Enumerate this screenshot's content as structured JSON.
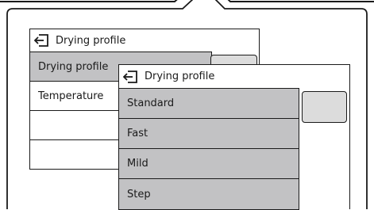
{
  "back_menu": {
    "title": "Drying profile",
    "rows": [
      {
        "label": "Drying profile",
        "selected": true
      },
      {
        "label": "Temperature",
        "selected": false
      },
      {
        "label": "",
        "selected": false
      },
      {
        "label": "",
        "selected": false
      }
    ]
  },
  "front_menu": {
    "title": "Drying profile",
    "options": [
      {
        "label": "Standard"
      },
      {
        "label": "Fast"
      },
      {
        "label": "Mild"
      },
      {
        "label": "Step"
      }
    ]
  },
  "icons": {
    "back": "back-arrow-icon"
  },
  "colors": {
    "selected_row": "#c2c2c4",
    "scroll_thumb": "#dcdcdc",
    "outline": "#1a1a1a"
  }
}
